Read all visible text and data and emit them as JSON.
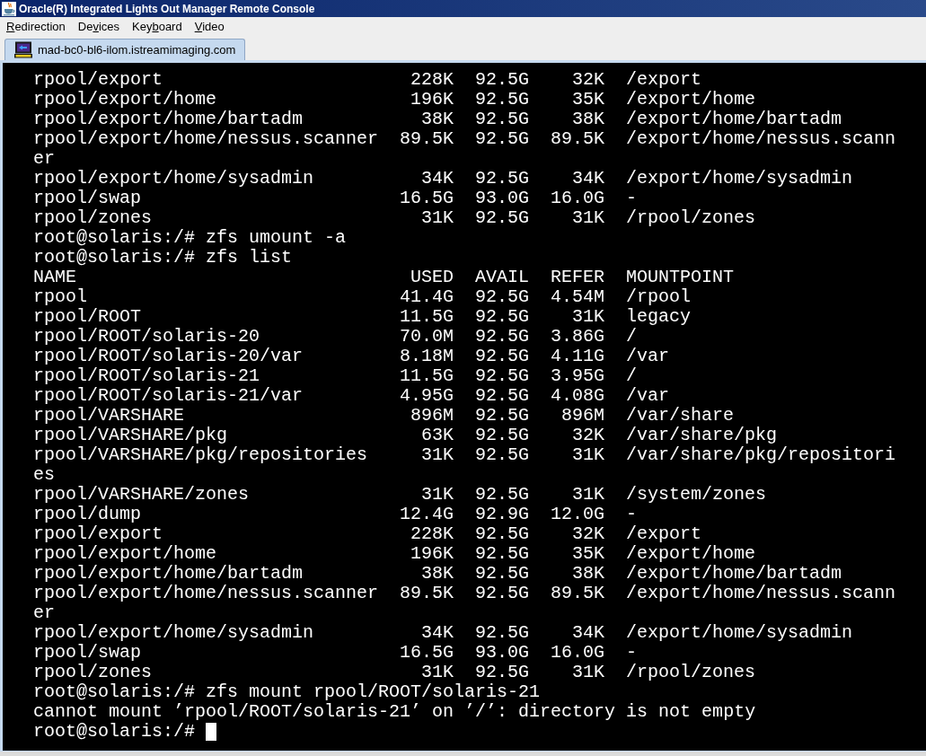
{
  "window": {
    "title": "Oracle(R) Integrated Lights Out Manager Remote Console"
  },
  "menu": [
    {
      "mnemonic": "R",
      "after": "edirection"
    },
    {
      "before": "De",
      "mnemonic": "v",
      "after": "ices"
    },
    {
      "before": "Key",
      "mnemonic": "b",
      "after": "oard"
    },
    {
      "mnemonic": "V",
      "after": "ideo"
    }
  ],
  "tabs": [
    {
      "label": "mad-bc0-bl6-ilom.istreamimaging.com",
      "selected": true
    }
  ],
  "terminal": {
    "lines": [
      {
        "kind": "row",
        "cells": [
          "rpool/export",
          "228K",
          "92.5G",
          "32K",
          "/export"
        ]
      },
      {
        "kind": "row",
        "cells": [
          "rpool/export/home",
          "196K",
          "92.5G",
          "35K",
          "/export/home"
        ]
      },
      {
        "kind": "row",
        "cells": [
          "rpool/export/home/bartadm",
          "38K",
          "92.5G",
          "38K",
          "/export/home/bartadm"
        ]
      },
      {
        "kind": "row",
        "cells": [
          "rpool/export/home/nessus.scanner",
          "89.5K",
          "92.5G",
          "89.5K",
          "/export/home/nessus.scann"
        ]
      },
      {
        "kind": "text",
        "text": "er"
      },
      {
        "kind": "row",
        "cells": [
          "rpool/export/home/sysadmin",
          "34K",
          "92.5G",
          "34K",
          "/export/home/sysadmin"
        ]
      },
      {
        "kind": "row",
        "cells": [
          "rpool/swap",
          "16.5G",
          "93.0G",
          "16.0G",
          "-"
        ]
      },
      {
        "kind": "row",
        "cells": [
          "rpool/zones",
          "31K",
          "92.5G",
          "31K",
          "/rpool/zones"
        ]
      },
      {
        "kind": "text",
        "text": "root@solaris:/# zfs umount -a"
      },
      {
        "kind": "text",
        "text": "root@solaris:/# zfs list"
      },
      {
        "kind": "header",
        "cells": [
          "NAME",
          "USED",
          "AVAIL",
          "REFER",
          "MOUNTPOINT"
        ]
      },
      {
        "kind": "row",
        "cells": [
          "rpool",
          "41.4G",
          "92.5G",
          "4.54M",
          "/rpool"
        ]
      },
      {
        "kind": "row",
        "cells": [
          "rpool/ROOT",
          "11.5G",
          "92.5G",
          "31K",
          "legacy"
        ]
      },
      {
        "kind": "row",
        "cells": [
          "rpool/ROOT/solaris-20",
          "70.0M",
          "92.5G",
          "3.86G",
          "/"
        ]
      },
      {
        "kind": "row",
        "cells": [
          "rpool/ROOT/solaris-20/var",
          "8.18M",
          "92.5G",
          "4.11G",
          "/var"
        ]
      },
      {
        "kind": "row",
        "cells": [
          "rpool/ROOT/solaris-21",
          "11.5G",
          "92.5G",
          "3.95G",
          "/"
        ]
      },
      {
        "kind": "row",
        "cells": [
          "rpool/ROOT/solaris-21/var",
          "4.95G",
          "92.5G",
          "4.08G",
          "/var"
        ]
      },
      {
        "kind": "row",
        "cells": [
          "rpool/VARSHARE",
          "896M",
          "92.5G",
          "896M",
          "/var/share"
        ]
      },
      {
        "kind": "row",
        "cells": [
          "rpool/VARSHARE/pkg",
          "63K",
          "92.5G",
          "32K",
          "/var/share/pkg"
        ]
      },
      {
        "kind": "row",
        "cells": [
          "rpool/VARSHARE/pkg/repositories",
          "31K",
          "92.5G",
          "31K",
          "/var/share/pkg/repositori"
        ]
      },
      {
        "kind": "text",
        "text": "es"
      },
      {
        "kind": "row",
        "cells": [
          "rpool/VARSHARE/zones",
          "31K",
          "92.5G",
          "31K",
          "/system/zones"
        ]
      },
      {
        "kind": "row",
        "cells": [
          "rpool/dump",
          "12.4G",
          "92.9G",
          "12.0G",
          "-"
        ]
      },
      {
        "kind": "row",
        "cells": [
          "rpool/export",
          "228K",
          "92.5G",
          "32K",
          "/export"
        ]
      },
      {
        "kind": "row",
        "cells": [
          "rpool/export/home",
          "196K",
          "92.5G",
          "35K",
          "/export/home"
        ]
      },
      {
        "kind": "row",
        "cells": [
          "rpool/export/home/bartadm",
          "38K",
          "92.5G",
          "38K",
          "/export/home/bartadm"
        ]
      },
      {
        "kind": "row",
        "cells": [
          "rpool/export/home/nessus.scanner",
          "89.5K",
          "92.5G",
          "89.5K",
          "/export/home/nessus.scann"
        ]
      },
      {
        "kind": "text",
        "text": "er"
      },
      {
        "kind": "row",
        "cells": [
          "rpool/export/home/sysadmin",
          "34K",
          "92.5G",
          "34K",
          "/export/home/sysadmin"
        ]
      },
      {
        "kind": "row",
        "cells": [
          "rpool/swap",
          "16.5G",
          "93.0G",
          "16.0G",
          "-"
        ]
      },
      {
        "kind": "row",
        "cells": [
          "rpool/zones",
          "31K",
          "92.5G",
          "31K",
          "/rpool/zones"
        ]
      },
      {
        "kind": "text",
        "text": "root@solaris:/# zfs mount rpool/ROOT/solaris-21"
      },
      {
        "kind": "text",
        "text": "cannot mount ’rpool/ROOT/solaris-21’ on ’/’: directory is not empty"
      },
      {
        "kind": "prompt",
        "text": "root@solaris:/#"
      }
    ]
  }
}
